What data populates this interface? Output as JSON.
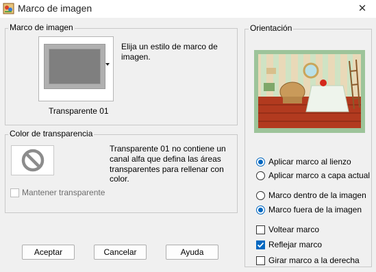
{
  "window": {
    "title": "Marco de imagen",
    "close_glyph": "✕",
    "app_icon": "paint-app-icon"
  },
  "frame_group": {
    "legend": "Marco de imagen",
    "hint": [
      "Elija un estilo de marco de",
      "imagen."
    ],
    "selected_frame": "Transparente 01"
  },
  "transparency_group": {
    "legend": "Color de transparencia",
    "info": [
      "Transparente 01 no contiene un",
      "canal alfa que defina las áreas",
      "transparentes para rellenar con",
      "color."
    ],
    "keep_transparent": {
      "label": "Mantener transparente",
      "checked": false,
      "enabled": false
    }
  },
  "orientation_group": {
    "legend": "Orientación",
    "apply_options": [
      {
        "label": "Aplicar marco al lienzo",
        "checked": true
      },
      {
        "label": "Aplicar marco a capa actual",
        "checked": false
      }
    ],
    "position_options": [
      {
        "label": "Marco dentro de la imagen",
        "checked": false
      },
      {
        "label": "Marco fuera de la imagen",
        "checked": true
      }
    ],
    "checkboxes": [
      {
        "label": "Voltear marco",
        "checked": false
      },
      {
        "label": "Reflejar marco",
        "checked": true
      },
      {
        "label": "Girar marco a la derecha",
        "checked": false
      }
    ]
  },
  "buttons": {
    "ok": "Aceptar",
    "cancel": "Cancelar",
    "help": "Ayuda"
  },
  "colors": {
    "accent": "#0067c0",
    "preview_frame": "#9dc49a"
  }
}
